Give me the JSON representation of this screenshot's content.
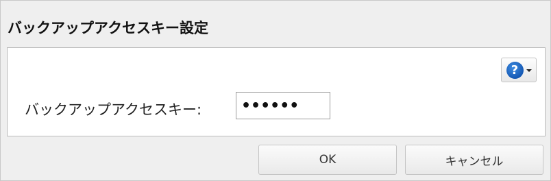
{
  "dialog": {
    "title": "バックアップアクセスキー設定"
  },
  "help": {
    "icon_glyph": "?",
    "icon_color": "#1e6fcf"
  },
  "form": {
    "label": "バックアップアクセスキー:",
    "value": "••••••"
  },
  "buttons": {
    "ok_label": "OK",
    "cancel_label": "キャンセル"
  }
}
